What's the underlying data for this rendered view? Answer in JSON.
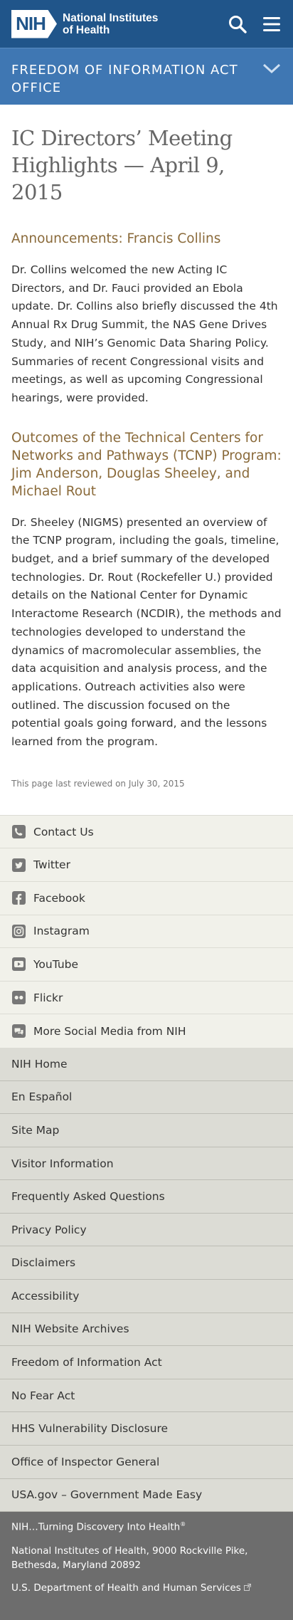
{
  "header": {
    "logo_mark": "NIH",
    "logo_line1": "National Institutes",
    "logo_line2": "of Health",
    "search_icon": "search-icon",
    "menu_icon": "hamburger-menu-icon"
  },
  "section": {
    "title": "Freedom of Information Act Office",
    "toggle_icon": "chevron-down-icon"
  },
  "article": {
    "title": "IC Directors’ Meeting Highlights — April 9, 2015",
    "sections": [
      {
        "heading": "Announcements: Francis Collins",
        "body": "Dr. Collins welcomed the new Acting IC Directors, and Dr. Fauci provided an Ebola update. Dr. Collins also briefly discussed the 4th Annual Rx Drug Summit, the NAS Gene Drives Study, and NIH’s Genomic Data Sharing Policy. Summaries of recent Congressional visits and meetings, as well as upcoming Congressional hearings, were provided."
      },
      {
        "heading": "Outcomes of the Technical Centers for Networks and Pathways (TCNP) Program: Jim Anderson, Douglas Sheeley, and Michael Rout",
        "body": "Dr. Sheeley (NIGMS) presented an overview of the TCNP program, including the goals, timeline, budget, and a brief summary of the developed technologies. Dr. Rout (Rockefeller U.) provided details on the National Center for Dynamic Interactome Research (NCDIR), the methods and technologies developed to understand the dynamics of macromolecular assemblies, the data acquisition and analysis process, and the applications. Outreach activities also were outlined. The discussion focused on the potential goals going forward, and the lessons learned from the program."
      }
    ],
    "reviewed": "This page last reviewed on July 30, 2015"
  },
  "social": [
    {
      "label": "Contact Us",
      "icon": "phone-icon"
    },
    {
      "label": "Twitter",
      "icon": "twitter-icon"
    },
    {
      "label": "Facebook",
      "icon": "facebook-icon"
    },
    {
      "label": "Instagram",
      "icon": "instagram-icon"
    },
    {
      "label": "YouTube",
      "icon": "youtube-icon"
    },
    {
      "label": "Flickr",
      "icon": "flickr-icon"
    },
    {
      "label": "More Social Media from NIH",
      "icon": "social-media-icon"
    }
  ],
  "links": [
    "NIH Home",
    "En Español",
    "Site Map",
    "Visitor Information",
    "Frequently Asked Questions",
    "Privacy Policy",
    "Disclaimers",
    "Accessibility",
    "NIH Website Archives",
    "Freedom of Information Act",
    "No Fear Act",
    "HHS Vulnerability Disclosure",
    "Office of Inspector General",
    "USA.gov – Government Made Easy"
  ],
  "bottom": {
    "tagline": "NIH…Turning Discovery Into Health",
    "tagline_mark": "®",
    "address": "National Institutes of Health, 9000 Rockville Pike, Bethesda, Maryland 20892",
    "hhs_label": "U.S. Department of Health and Human Services",
    "hhs_icon": "external-link-icon"
  },
  "colors": {
    "header_bg": "#20558a",
    "section_bg": "#3f77b3",
    "heading_accent": "#8a6a3a",
    "social_bg": "#f1f1ea",
    "links_bg": "#dcdcd5",
    "bottom_bg": "#6d6d6d"
  }
}
